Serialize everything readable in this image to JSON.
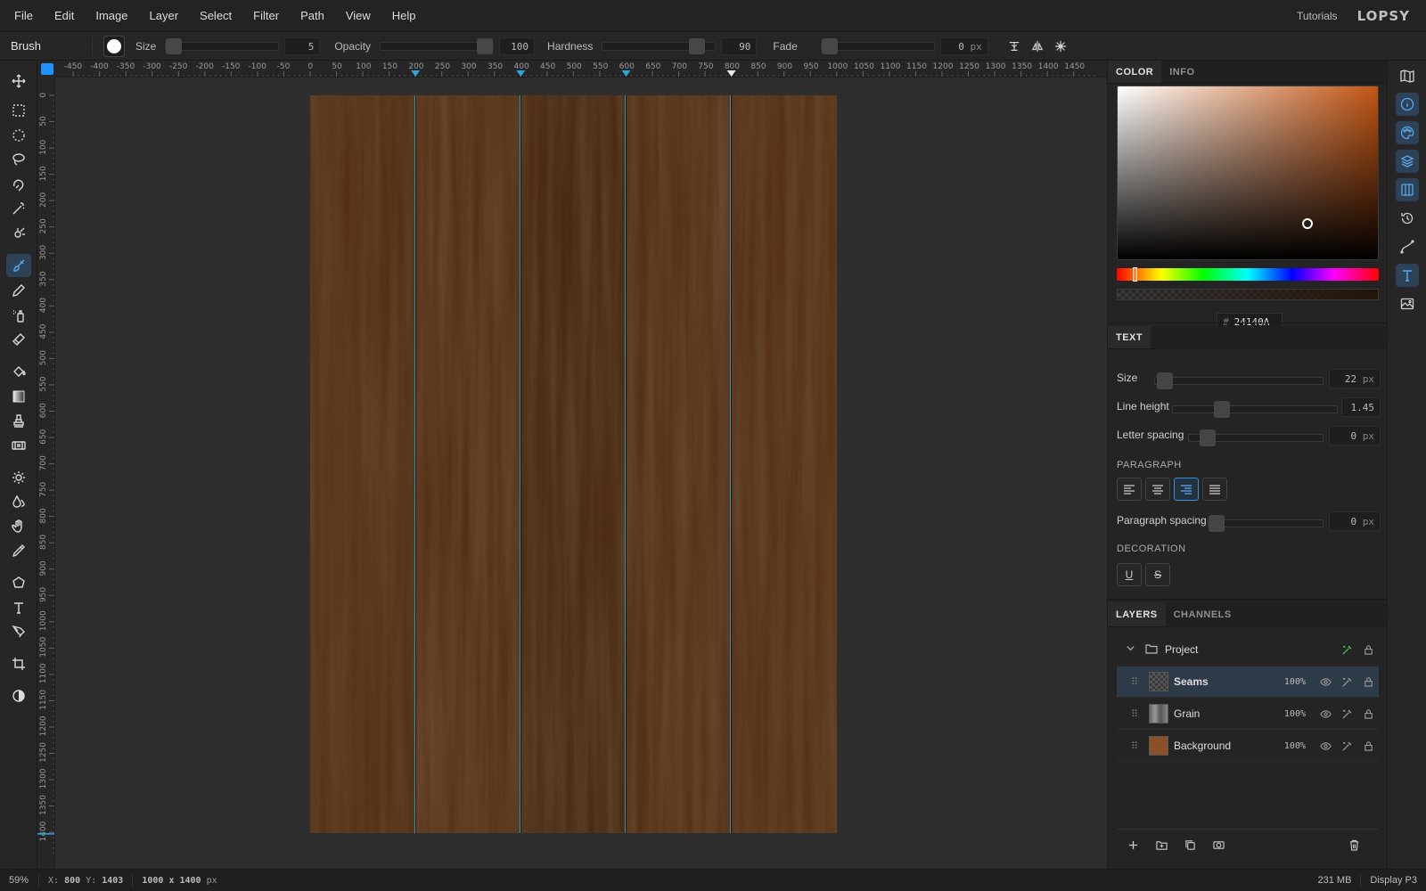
{
  "menu": [
    "File",
    "Edit",
    "Image",
    "Layer",
    "Select",
    "Filter",
    "Path",
    "View",
    "Help"
  ],
  "header": {
    "tutorials": "Tutorials",
    "logo": "LOPSY"
  },
  "options": {
    "tool": "Brush",
    "size_label": "Size",
    "size_value": "5",
    "opacity_label": "Opacity",
    "opacity_value": "100",
    "hardness_label": "Hardness",
    "hardness_value": "90",
    "fade_label": "Fade",
    "fade_value": "0",
    "fade_unit": "px"
  },
  "ruler": {
    "h_labels": [
      "-450",
      "-400",
      "-350",
      "-300",
      "-250",
      "-200",
      "-150",
      "-100",
      "-50",
      "0",
      "50",
      "100",
      "150",
      "200",
      "250",
      "300",
      "350",
      "400",
      "450",
      "500",
      "550",
      "600",
      "650",
      "700",
      "750",
      "800",
      "850",
      "900",
      "950",
      "1000",
      "1050",
      "1100",
      "1150",
      "1200",
      "1250",
      "1300",
      "1350",
      "1400",
      "1450"
    ],
    "v_labels": [
      "0",
      "50",
      "100",
      "150",
      "200",
      "250",
      "300",
      "350",
      "400",
      "450",
      "500",
      "550",
      "600",
      "650",
      "700",
      "750",
      "800",
      "850",
      "900",
      "950",
      "1000",
      "1050",
      "1100",
      "1150",
      "1200",
      "1250",
      "1300",
      "1350",
      "1400"
    ]
  },
  "color_panel": {
    "tabs": [
      "COLOR",
      "INFO"
    ],
    "hex_prefix": "#",
    "hex": "24140A",
    "hue_color": "#c25514"
  },
  "text_panel": {
    "title": "TEXT",
    "size_label": "Size",
    "size_value": "22",
    "size_unit": "px",
    "line_height_label": "Line height",
    "line_height_value": "1.45",
    "letter_spacing_label": "Letter spacing",
    "letter_spacing_value": "0",
    "letter_spacing_unit": "px",
    "paragraph_label": "PARAGRAPH",
    "paragraph_spacing_label": "Paragraph spacing",
    "paragraph_spacing_value": "0",
    "paragraph_spacing_unit": "px",
    "decoration_label": "DECORATION",
    "underline": "U",
    "strike": "S"
  },
  "layers_panel": {
    "tabs": [
      "LAYERS",
      "CHANNELS"
    ],
    "group": "Project",
    "layers": [
      {
        "name": "Seams",
        "opacity": "100%"
      },
      {
        "name": "Grain",
        "opacity": "100%"
      },
      {
        "name": "Background",
        "opacity": "100%"
      }
    ]
  },
  "status": {
    "zoom": "59%",
    "x_label": "X:",
    "x": "800",
    "y_label": "Y:",
    "y": "1403",
    "doc_size": "1000 x 1400",
    "doc_unit": "px",
    "memory": "231 MB",
    "display": "Display P3"
  },
  "colors": {
    "accent": "#3c8fd8",
    "guide": "#2aa8d8",
    "wood_dark": "#2a170a",
    "wood_light": "#6e3c17"
  }
}
